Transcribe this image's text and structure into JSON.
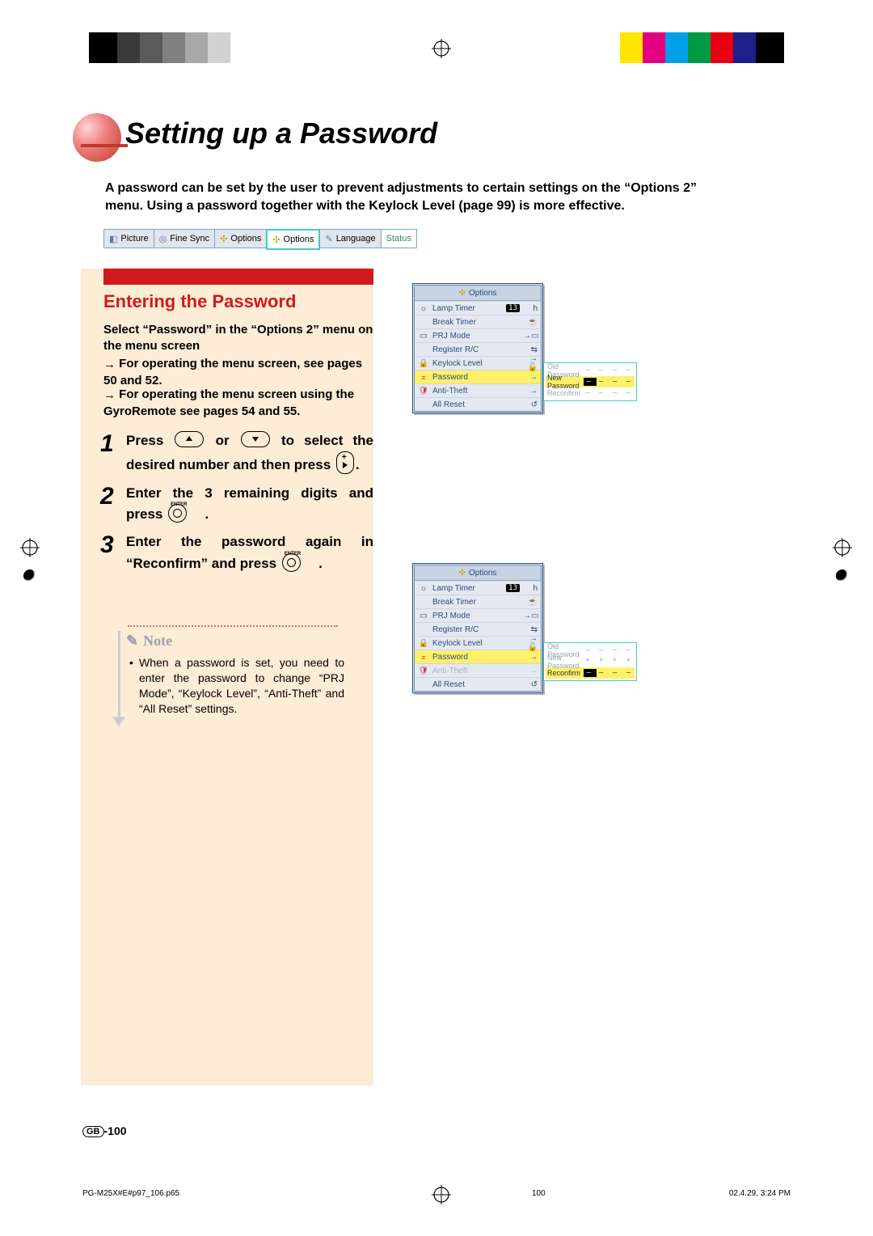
{
  "title": "Setting up a Password",
  "intro": "A password can be set by the user to prevent adjustments to certain settings on the “Options 2” menu. Using a password together with the Keylock Level (page 99) is more effective.",
  "tabs": {
    "picture": "Picture",
    "fine_sync": "Fine Sync",
    "options1": "Options",
    "options2": "Options",
    "language": "Language",
    "status": "Status"
  },
  "section_title": "Entering the Password",
  "select_line1": "Select “Password” in the “Options 2” menu on the menu screen",
  "arrow1": "For operating the menu screen, see pages 50 and 52.",
  "arrow2": "For operating the menu screen using the GyroRemote see pages 54 and 55.",
  "step1a": "Press ",
  "step1_or": " or ",
  "step1b": " to select the desired number and then press ",
  "step2a": "Enter the 3 remaining digits and press ",
  "step3a": "Enter the password again in “Reconfirm” and press ",
  "period": ".",
  "enter_label": "ENTER",
  "note_label": "Note",
  "note_text": "When a password is set, you need to enter the password to change “PRJ Mode”, “Keylock Level”, “Anti-Theft” and “All Reset” settings.",
  "menu": {
    "title": "Options",
    "lamp_timer": "Lamp Timer",
    "lamp_value": "13",
    "lamp_unit": "h",
    "break_timer": "Break Timer",
    "prj_mode": "PRJ Mode",
    "register_rc": "Register R/C",
    "keylock": "Keylock Level",
    "password": "Password",
    "anti_theft": "Anti-Theft",
    "all_reset": "All Reset"
  },
  "pw": {
    "old": "Old Password",
    "new": "New Password",
    "re": "Reconfirm",
    "dashes": "– – – –",
    "dash1": "–",
    "stars": "* * * *"
  },
  "page_label_prefix": "GB",
  "page_number": "-100",
  "footer": {
    "file": "PG-M25X#E#p97_106.p65",
    "num": "100",
    "date": "02.4.29, 3:24 PM"
  }
}
